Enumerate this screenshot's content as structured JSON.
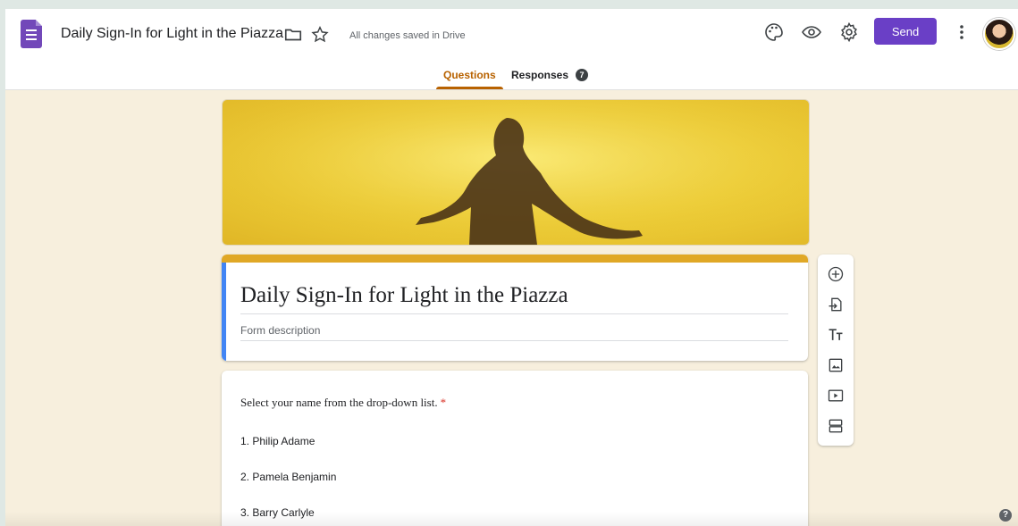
{
  "app": {
    "title": "Daily Sign-In for Light in the Piazza",
    "save_status": "All changes saved in Drive",
    "accent_color": "#6a3fc6"
  },
  "toolbar": {
    "send_label": "Send",
    "icons": [
      "palette-icon",
      "eye-icon",
      "gear-icon",
      "more-vert-icon"
    ]
  },
  "tabs": [
    {
      "label": "Questions",
      "active": true
    },
    {
      "label": "Responses",
      "badge": "7"
    }
  ],
  "form": {
    "title": "Daily Sign-In for Light in the Piazza",
    "description_placeholder": "Form description",
    "theme_color": "#e0a826"
  },
  "question": {
    "text": "Select your name from the drop-down list.",
    "required_marker": "*",
    "options": [
      "1.  Philip Adame",
      "2.  Pamela Benjamin",
      "3.  Barry Carlyle"
    ]
  },
  "side_toolbar": {
    "icons": [
      "add-question-icon",
      "import-questions-icon",
      "add-title-icon",
      "add-image-icon",
      "add-video-icon",
      "add-section-icon"
    ]
  },
  "help": {
    "label": "?"
  }
}
